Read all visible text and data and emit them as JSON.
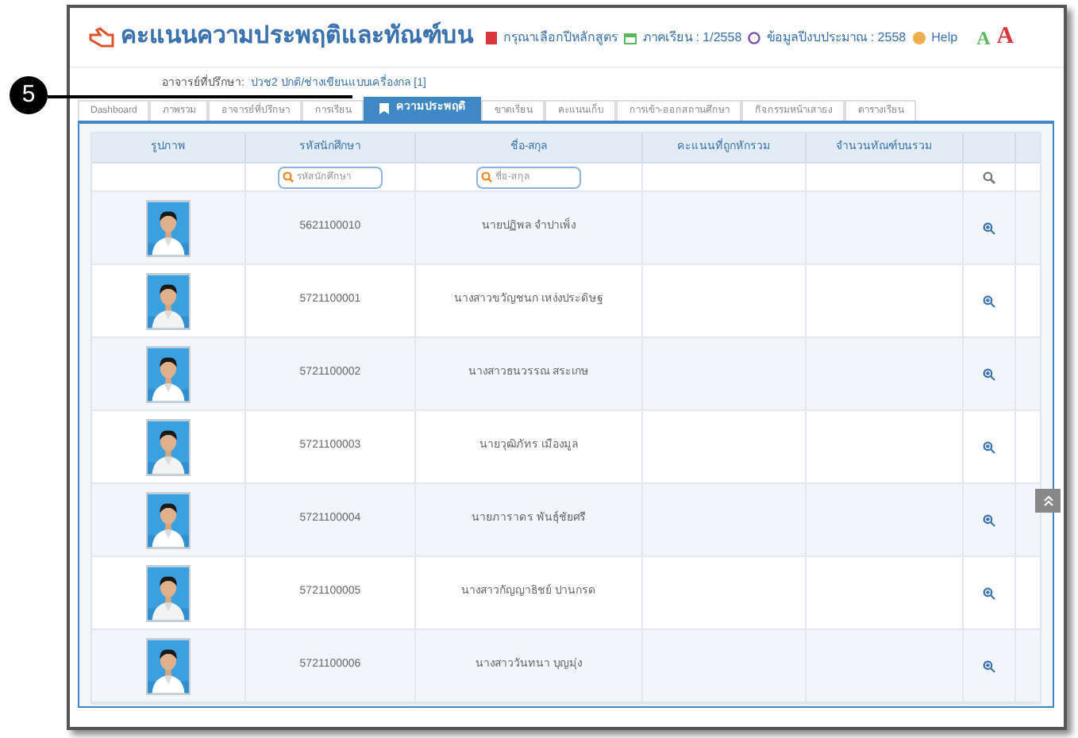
{
  "header": {
    "title": "คะแนนความประพฤติและทัณฑ์บน",
    "course_link": "กรุณาเลือกปีหลักสูตร",
    "term": "ภาคเรียน : 1/2558",
    "budget_year": "ข้อมูลปีงบประมาณ : 2558",
    "help": "Help",
    "font_small": "A",
    "font_large": "A"
  },
  "advisor": {
    "label": "อาจารย์ที่ปรึกษา:",
    "value": "ปวช2 ปกติ/ช่างเขียนแบบเครื่องกล [1]"
  },
  "callout": "5",
  "tabs": [
    {
      "label": "Dashboard",
      "selected": false
    },
    {
      "label": "ภาพรวม",
      "selected": false
    },
    {
      "label": "อาจารย์ที่ปรึกษา",
      "selected": false
    },
    {
      "label": "การเรียน",
      "selected": false
    },
    {
      "label": "ความประพฤติ",
      "selected": true
    },
    {
      "label": "ขาดเรียน",
      "selected": false
    },
    {
      "label": "คะแนนเก็บ",
      "selected": false
    },
    {
      "label": "การเข้า-ออกสถานศึกษา",
      "selected": false
    },
    {
      "label": "กิจกรรมหน้าเสาธง",
      "selected": false
    },
    {
      "label": "ตารางเรียน",
      "selected": false
    }
  ],
  "table": {
    "columns": [
      "รูปภาพ",
      "รหัสนักศึกษา",
      "ชื่อ-สกุล",
      "คะแนนที่ถูกหักรวม",
      "จำนวนทัณฑ์บนรวม"
    ],
    "filters": {
      "id_placeholder": "รหัสนักศึกษา",
      "name_placeholder": "ชื่อ-สกุล"
    },
    "rows": [
      {
        "id": "5621100010",
        "name": "นายปฏิพล จำปาเพ็ง"
      },
      {
        "id": "5721100001",
        "name": "นางสาวขวัญชนก เหง่งประดิษฐ"
      },
      {
        "id": "5721100002",
        "name": "นางสาวธนวรรณ สระเกษ"
      },
      {
        "id": "5721100003",
        "name": "นายวุฒิภัทร เมืองมูล"
      },
      {
        "id": "5721100004",
        "name": "นายภาราดร พันธุ์ชัยศรี"
      },
      {
        "id": "5721100005",
        "name": "นางสาวกัญญาธิชย์ ปานกรด"
      },
      {
        "id": "5721100006",
        "name": "นางสาววันทนา บุญมุ่ง"
      }
    ]
  }
}
